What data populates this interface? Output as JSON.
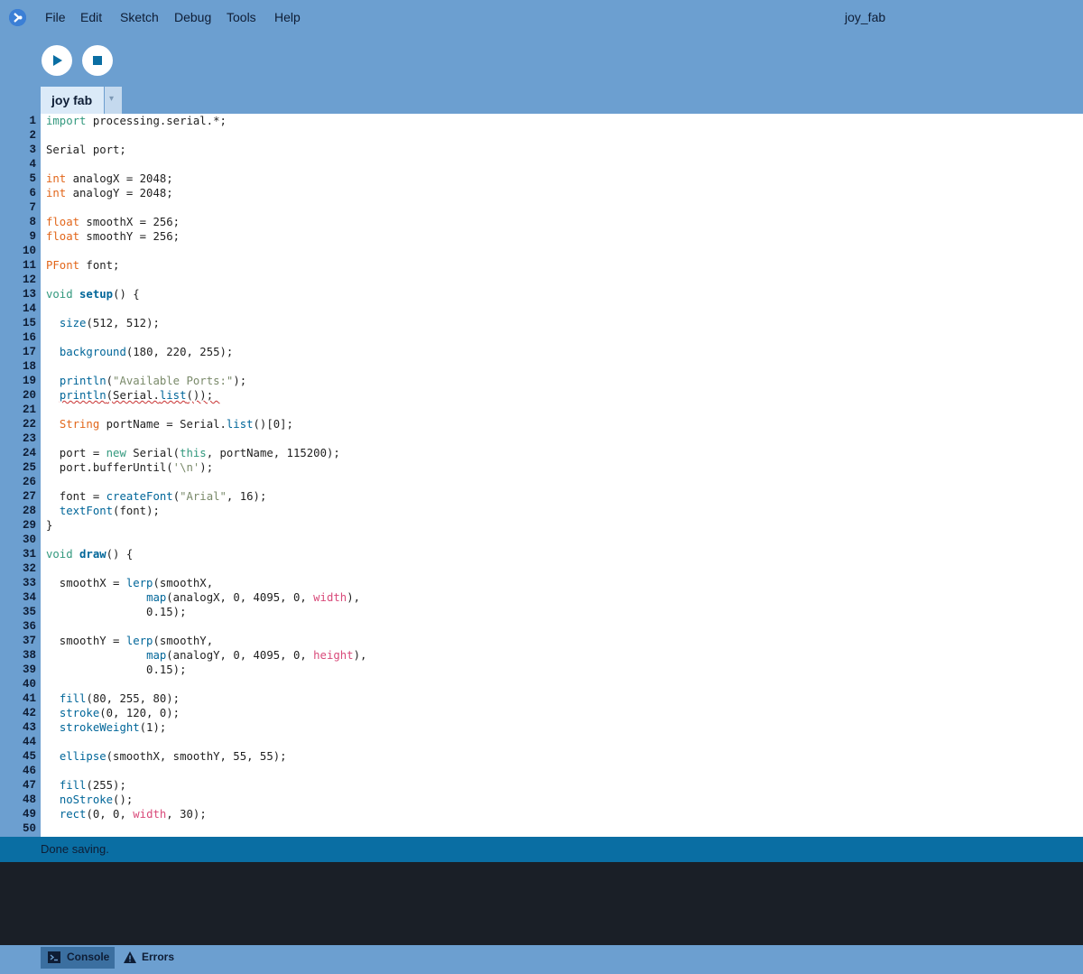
{
  "menubar": {
    "items": [
      "File",
      "Edit",
      "Sketch",
      "Debug",
      "Tools",
      "Help"
    ],
    "window_title": "joy_fab"
  },
  "toolbar": {
    "run_icon": "play-icon",
    "stop_icon": "stop-icon"
  },
  "tabs": {
    "active": "joy fab",
    "menu_glyph": "▾"
  },
  "editor": {
    "lines": [
      [
        [
          "k",
          "import"
        ],
        [
          "p",
          " processing.serial.*;"
        ]
      ],
      [],
      [
        [
          "p",
          "Serial port;"
        ]
      ],
      [],
      [
        [
          "t",
          "int"
        ],
        [
          "p",
          " analogX = 2048;"
        ]
      ],
      [
        [
          "t",
          "int"
        ],
        [
          "p",
          " analogY = 2048;"
        ]
      ],
      [],
      [
        [
          "t",
          "float"
        ],
        [
          "p",
          " smoothX = 256;"
        ]
      ],
      [
        [
          "t",
          "float"
        ],
        [
          "p",
          " smoothY = 256;"
        ]
      ],
      [],
      [
        [
          "t",
          "PFont"
        ],
        [
          "p",
          " font;"
        ]
      ],
      [],
      [
        [
          "k",
          "void"
        ],
        [
          "p",
          " "
        ],
        [
          "fb",
          "setup"
        ],
        [
          "p",
          "() {"
        ]
      ],
      [],
      [
        [
          "p",
          "  "
        ],
        [
          "f",
          "size"
        ],
        [
          "p",
          "(512, 512);"
        ]
      ],
      [],
      [
        [
          "p",
          "  "
        ],
        [
          "f",
          "background"
        ],
        [
          "p",
          "(180, 220, 255);"
        ]
      ],
      [],
      [
        [
          "p",
          "  "
        ],
        [
          "f",
          "println"
        ],
        [
          "p",
          "("
        ],
        [
          "s2",
          "\"Available Ports:\""
        ],
        [
          "p",
          ");"
        ]
      ],
      [
        [
          "p",
          "  "
        ],
        [
          "fu",
          "println"
        ],
        [
          "u",
          "(Serial."
        ],
        [
          "fu",
          "list"
        ],
        [
          "u",
          "()); "
        ]
      ],
      [],
      [
        [
          "p",
          "  "
        ],
        [
          "t",
          "String"
        ],
        [
          "p",
          " portName = Serial."
        ],
        [
          "f",
          "list"
        ],
        [
          "p",
          "()[0];"
        ]
      ],
      [],
      [
        [
          "p",
          "  port = "
        ],
        [
          "k",
          "new"
        ],
        [
          "p",
          " Serial("
        ],
        [
          "k",
          "this"
        ],
        [
          "p",
          ", portName, 115200);"
        ]
      ],
      [
        [
          "p",
          "  port.bufferUntil("
        ],
        [
          "s2",
          "'\\n'"
        ],
        [
          "p",
          ");"
        ]
      ],
      [],
      [
        [
          "p",
          "  font = "
        ],
        [
          "f",
          "createFont"
        ],
        [
          "p",
          "("
        ],
        [
          "s2",
          "\"Arial\""
        ],
        [
          "p",
          ", 16);"
        ]
      ],
      [
        [
          "p",
          "  "
        ],
        [
          "f",
          "textFont"
        ],
        [
          "p",
          "(font);"
        ]
      ],
      [
        [
          "p",
          "}"
        ]
      ],
      [],
      [
        [
          "k",
          "void"
        ],
        [
          "p",
          " "
        ],
        [
          "fb",
          "draw"
        ],
        [
          "p",
          "() {"
        ]
      ],
      [],
      [
        [
          "p",
          "  smoothX = "
        ],
        [
          "f",
          "lerp"
        ],
        [
          "p",
          "(smoothX,"
        ]
      ],
      [
        [
          "p",
          "               "
        ],
        [
          "f",
          "map"
        ],
        [
          "p",
          "(analogX, 0, 4095, 0, "
        ],
        [
          "c",
          "width"
        ],
        [
          "p",
          "),"
        ]
      ],
      [
        [
          "p",
          "               0.15);"
        ]
      ],
      [],
      [
        [
          "p",
          "  smoothY = "
        ],
        [
          "f",
          "lerp"
        ],
        [
          "p",
          "(smoothY,"
        ]
      ],
      [
        [
          "p",
          "               "
        ],
        [
          "f",
          "map"
        ],
        [
          "p",
          "(analogY, 0, 4095, 0, "
        ],
        [
          "c",
          "height"
        ],
        [
          "p",
          "),"
        ]
      ],
      [
        [
          "p",
          "               0.15);"
        ]
      ],
      [],
      [
        [
          "p",
          "  "
        ],
        [
          "f",
          "fill"
        ],
        [
          "p",
          "(80, 255, 80);"
        ]
      ],
      [
        [
          "p",
          "  "
        ],
        [
          "f",
          "stroke"
        ],
        [
          "p",
          "(0, 120, 0);"
        ]
      ],
      [
        [
          "p",
          "  "
        ],
        [
          "f",
          "strokeWeight"
        ],
        [
          "p",
          "(1);"
        ]
      ],
      [],
      [
        [
          "p",
          "  "
        ],
        [
          "f",
          "ellipse"
        ],
        [
          "p",
          "(smoothX, smoothY, 55, 55);"
        ]
      ],
      [],
      [
        [
          "p",
          "  "
        ],
        [
          "f",
          "fill"
        ],
        [
          "p",
          "(255);"
        ]
      ],
      [
        [
          "p",
          "  "
        ],
        [
          "f",
          "noStroke"
        ],
        [
          "p",
          "();"
        ]
      ],
      [
        [
          "p",
          "  "
        ],
        [
          "f",
          "rect"
        ],
        [
          "p",
          "(0, 0, "
        ],
        [
          "c",
          "width"
        ],
        [
          "p",
          ", 30);"
        ]
      ],
      []
    ]
  },
  "status": {
    "message": "Done saving."
  },
  "bottom_tabs": [
    {
      "label": "Console",
      "icon": "terminal-icon"
    },
    {
      "label": "Errors",
      "icon": "warning-icon"
    }
  ],
  "colors": {
    "chrome": "#6c9fd0",
    "status_bar": "#0a6ea3",
    "console_bg": "#1a1f27",
    "keyword": "#33997e",
    "type": "#e2661a",
    "function": "#006699",
    "constant": "#d94a7a"
  }
}
